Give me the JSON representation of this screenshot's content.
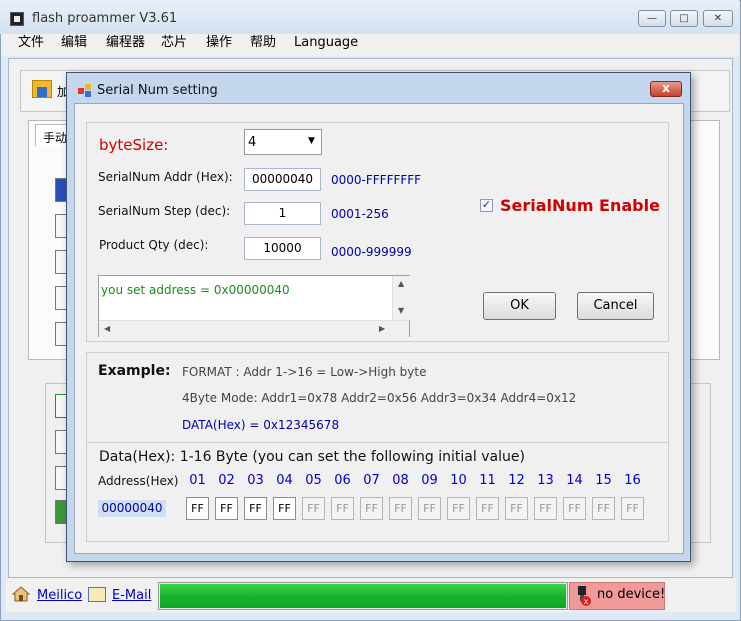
{
  "app": {
    "title": "flash proammer V3.61"
  },
  "menu": [
    "文件",
    "编辑",
    "编程器",
    "芯片",
    "操作",
    "帮助",
    "Language"
  ],
  "toolbar": {
    "truncated_label": "加"
  },
  "tab": {
    "manual": "手动"
  },
  "dialog": {
    "title": "Serial Num setting",
    "close_glyph": "x",
    "bytesize": {
      "label": "byteSize:",
      "value": "4"
    },
    "fields": [
      {
        "label": "SerialNum Addr (Hex):",
        "value": "00000040",
        "range": "0000-FFFFFFFF"
      },
      {
        "label": "SerialNum Step (dec):",
        "value": "1",
        "range": "0001-256"
      },
      {
        "label": "Product Qty (dec):",
        "value": "10000",
        "range": "0000-999999"
      }
    ],
    "serialnum_enable": {
      "label": "SerialNum Enable",
      "checked": true,
      "check_glyph": "✓"
    },
    "log_text": "you set address = 0x00000040",
    "buttons": {
      "ok": "OK",
      "cancel": "Cancel"
    },
    "example": {
      "label": "Example:",
      "format": "FORMAT : Addr  1->16  = Low->High byte",
      "mode": "4Byte Mode:  Addr1=0x78  Addr2=0x56  Addr3=0x34  Addr4=0x12",
      "data": "DATA(Hex) =  0x12345678"
    },
    "data": {
      "title": "Data(Hex):  1-16 Byte  (you can set the following initial value)",
      "address_header": "Address(Hex)",
      "columns": [
        "01",
        "02",
        "03",
        "04",
        "05",
        "06",
        "07",
        "08",
        "09",
        "10",
        "11",
        "12",
        "13",
        "14",
        "15",
        "16"
      ],
      "address_value": "00000040",
      "cells": [
        "FF",
        "FF",
        "FF",
        "FF",
        "FF",
        "FF",
        "FF",
        "FF",
        "FF",
        "FF",
        "FF",
        "FF",
        "FF",
        "FF",
        "FF",
        "FF"
      ],
      "enabled_count": 4
    }
  },
  "status": {
    "meilico": "Meilico",
    "email": "E-Mail",
    "progress": 1.0,
    "no_device": "no device!"
  }
}
